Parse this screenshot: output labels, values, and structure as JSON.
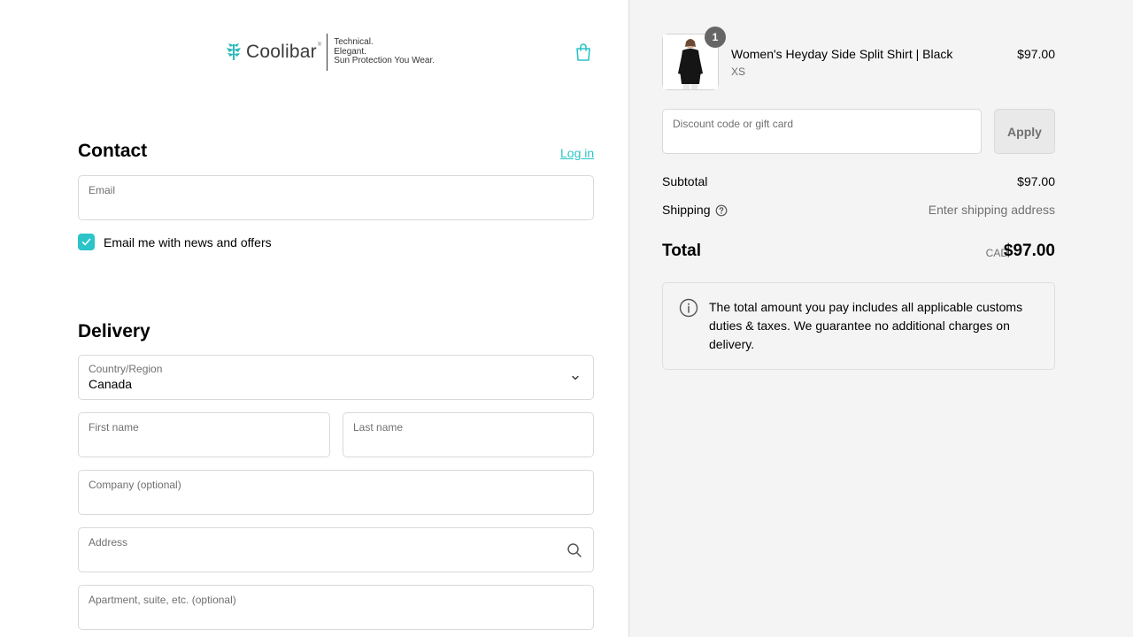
{
  "header": {
    "brand": "Coolibar",
    "brand_mark": "®",
    "tagline_1": "Technical.",
    "tagline_2": "Elegant.",
    "tagline_3": "Sun Protection You Wear.",
    "cart_icon": "shopping-bag-icon"
  },
  "contact": {
    "title": "Contact",
    "login_label": "Log in",
    "email_label": "Email",
    "email_value": "",
    "news_label": "Email me with news and offers",
    "news_checked": true
  },
  "delivery": {
    "title": "Delivery",
    "country_label": "Country/Region",
    "country_value": "Canada",
    "first_name_label": "First name",
    "last_name_label": "Last name",
    "company_label": "Company (optional)",
    "address_label": "Address",
    "apartment_label": "Apartment, suite, etc. (optional)"
  },
  "summary": {
    "product": {
      "name": "Women's Heyday Side Split Shirt | Black",
      "variant": "XS",
      "price": "$97.00",
      "quantity": "1"
    },
    "discount_placeholder": "Discount code or gift card",
    "apply_label": "Apply",
    "subtotal_label": "Subtotal",
    "subtotal_value": "$97.00",
    "shipping_label": "Shipping",
    "shipping_value": "Enter shipping address",
    "total_label": "Total",
    "total_currency": "CAD",
    "total_value": "$97.00",
    "notice": "The total amount you pay includes all applicable customs duties & taxes. We guarantee no additional charges on delivery."
  },
  "colors": {
    "accent": "#2bc4c8",
    "summary_bg": "#f4f4f4",
    "muted_text": "#707070"
  }
}
